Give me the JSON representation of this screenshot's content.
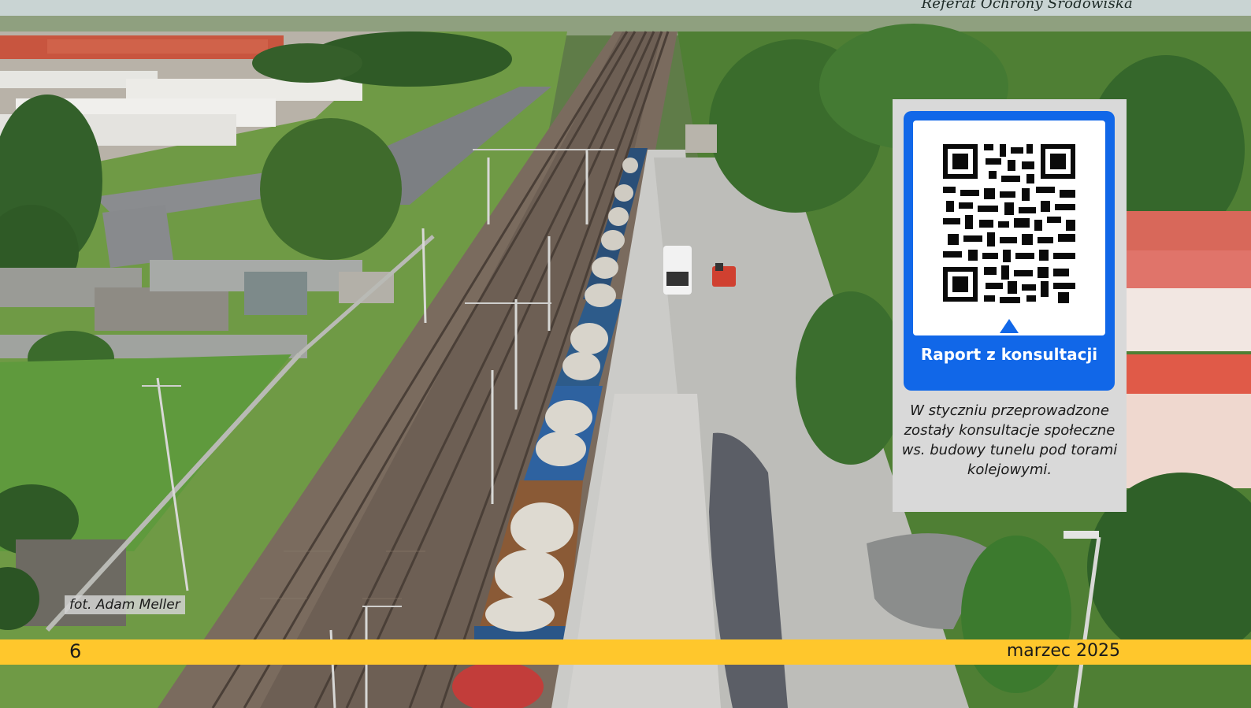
{
  "header": {
    "text": "Referat Ochrony Środowiska"
  },
  "qr_card": {
    "label": "Raport z konsultacji",
    "caption": "W styczniu przeprowadzone zostały konsultacje społeczne ws. budowy tunelu pod torami kolejowymi.",
    "icon": "qr-code-icon",
    "accent_color": "#1167e8"
  },
  "photo": {
    "credit": "fot. Adam Meller"
  },
  "footer": {
    "page_number": "6",
    "issue_date": "marzec 2025",
    "band_color": "#ffc72c"
  }
}
